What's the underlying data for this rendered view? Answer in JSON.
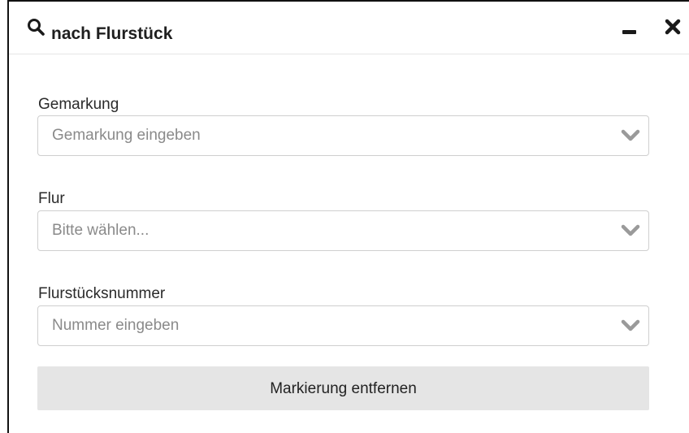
{
  "header": {
    "title": "nach Flurstück",
    "icons": {
      "search": "search-icon",
      "minimize": "minimize-icon",
      "close": "close-icon"
    }
  },
  "fields": [
    {
      "label": "Gemarkung",
      "placeholder": "Gemarkung eingeben"
    },
    {
      "label": "Flur",
      "placeholder": "Bitte wählen..."
    },
    {
      "label": "Flurstücksnummer",
      "placeholder": "Nummer eingeben"
    }
  ],
  "actions": {
    "clear_label": "Markierung entfernen"
  },
  "colors": {
    "text": "#222222",
    "placeholder": "#8a8a8a",
    "border": "#cfcfcf",
    "button_bg": "#e5e5e5",
    "chevron": "#9a9a9a"
  }
}
